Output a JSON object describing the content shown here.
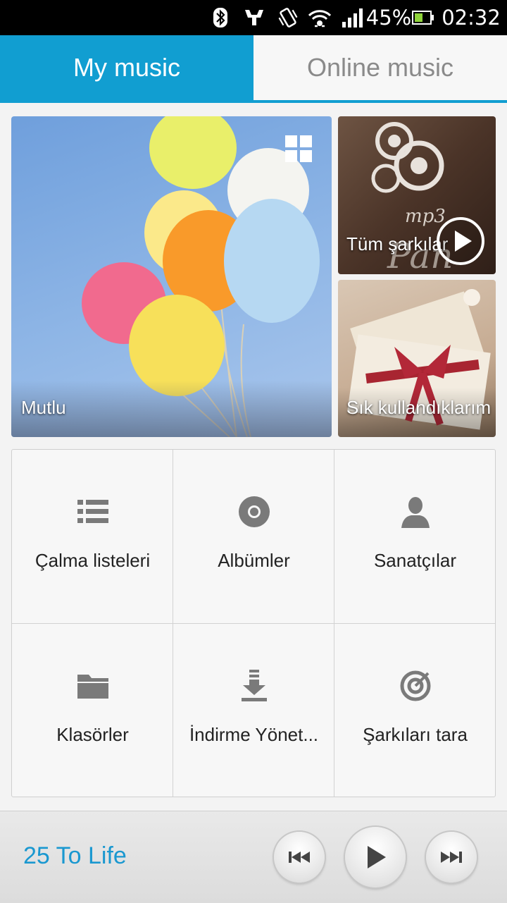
{
  "status_bar": {
    "battery": "45%",
    "time": "02:32"
  },
  "tabs": [
    {
      "label": "My music",
      "active": true
    },
    {
      "label": "Online music",
      "active": false
    }
  ],
  "tiles": {
    "mutlu": {
      "label": "Mutlu"
    },
    "all_songs": {
      "label": "Tüm şarkılar"
    },
    "frequent": {
      "label": "Sık kullandıklarım"
    }
  },
  "categories": [
    {
      "label": "Çalma listeleri",
      "icon": "playlist-icon"
    },
    {
      "label": "Albümler",
      "icon": "album-icon"
    },
    {
      "label": "Sanatçılar",
      "icon": "artist-icon"
    },
    {
      "label": "Klasörler",
      "icon": "folder-icon"
    },
    {
      "label": "İndirme Yönet...",
      "icon": "download-icon"
    },
    {
      "label": "Şarkıları tara",
      "icon": "scan-icon"
    }
  ],
  "player": {
    "song_title": "25 To Life"
  },
  "colors": {
    "accent": "#119ed1",
    "song_title": "#1a98d0",
    "icon_gray": "#7a7a7a"
  }
}
